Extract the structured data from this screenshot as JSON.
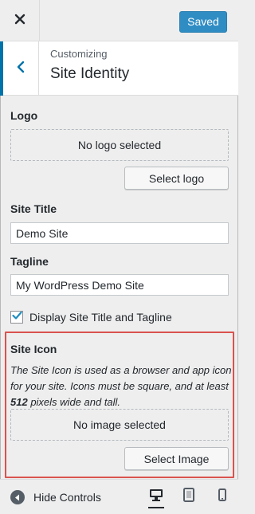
{
  "header": {
    "saved_label": "Saved",
    "breadcrumb": "Customizing",
    "section_title": "Site Identity"
  },
  "logo": {
    "label": "Logo",
    "placeholder": "No logo selected",
    "button_label": "Select logo"
  },
  "site_title": {
    "label": "Site Title",
    "value": "Demo Site"
  },
  "tagline": {
    "label": "Tagline",
    "value": "My WordPress Demo Site"
  },
  "display_title_tagline": {
    "label": "Display Site Title and Tagline",
    "checked": true
  },
  "site_icon": {
    "label": "Site Icon",
    "description_before": "The Site Icon is used as a browser and app icon for your site. Icons must be square, and at least ",
    "description_size": "512",
    "description_after": " pixels wide and tall.",
    "placeholder": "No image selected",
    "button_label": "Select Image",
    "highlight_color": "#d9534f"
  },
  "footer": {
    "hide_controls_label": "Hide Controls",
    "devices": [
      "desktop-icon",
      "tablet-icon",
      "mobile-icon"
    ],
    "active_device": "desktop"
  },
  "colors": {
    "accent": "#0073aa",
    "saved_button": "#2f8dc4",
    "background": "#eeeeee"
  }
}
